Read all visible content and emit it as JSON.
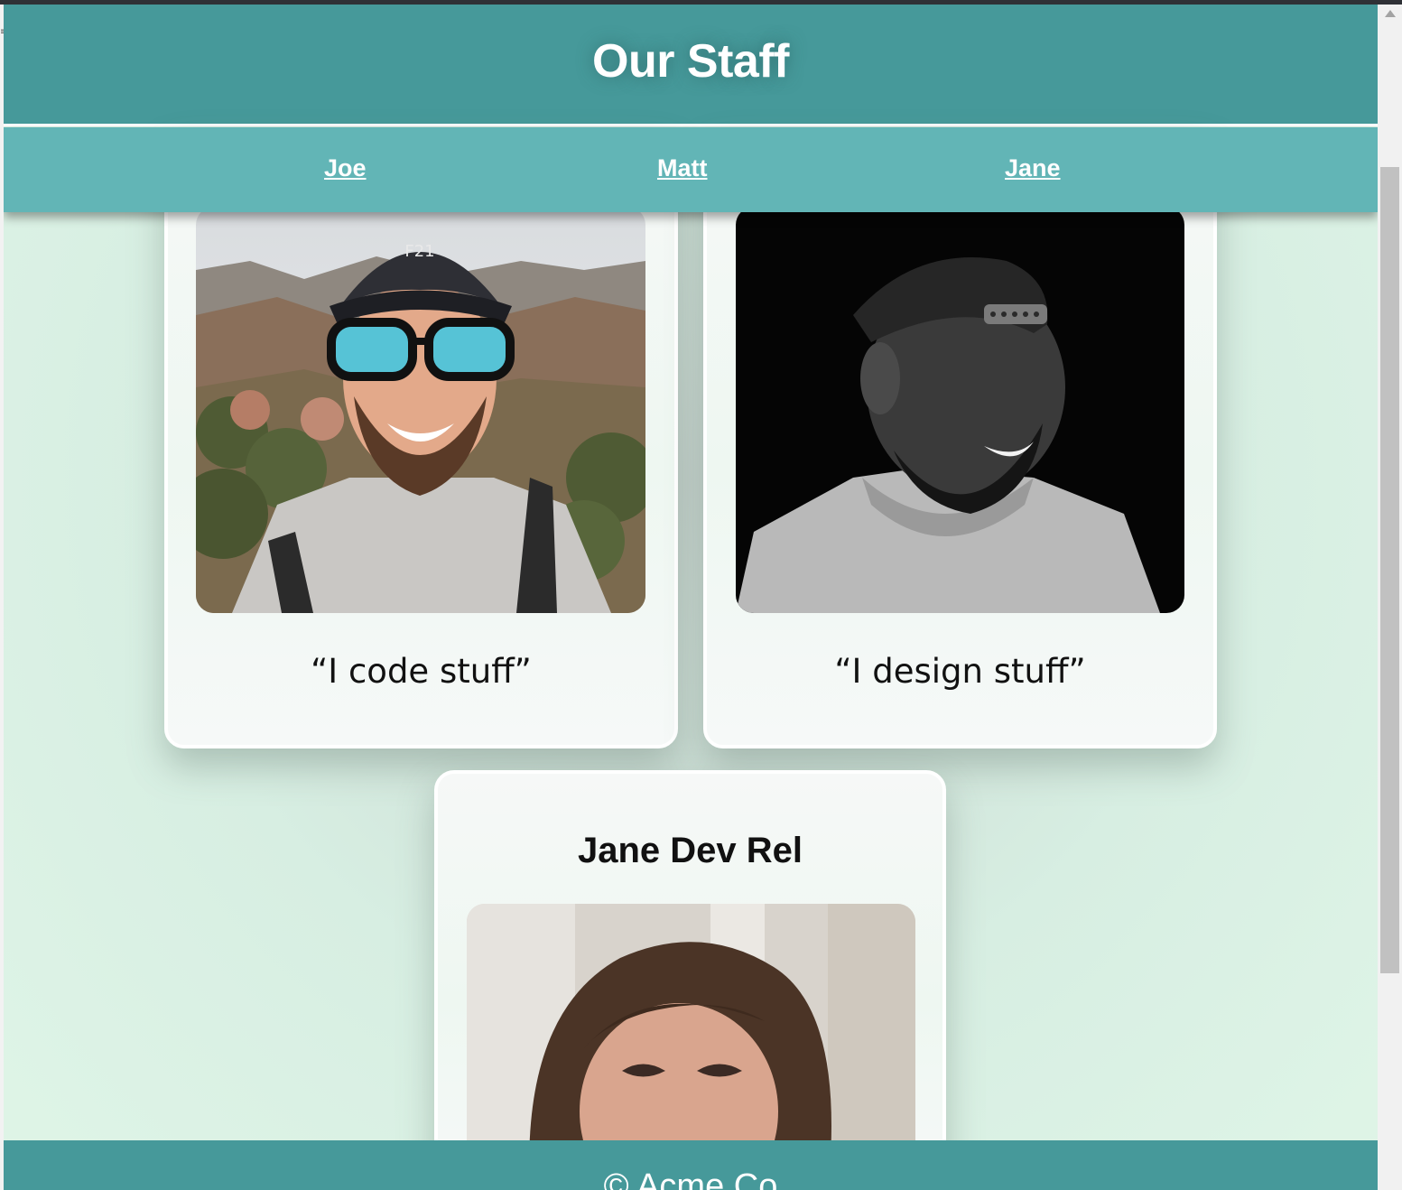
{
  "header": {
    "title": "Our Staff"
  },
  "nav": {
    "items": [
      "Joe",
      "Matt",
      "Jane"
    ]
  },
  "cards": [
    {
      "quote": "“I code stuff”"
    },
    {
      "quote": "“I design stuff”"
    },
    {
      "title": "Jane Dev Rel"
    }
  ],
  "footer": {
    "text": "© Acme Co"
  }
}
